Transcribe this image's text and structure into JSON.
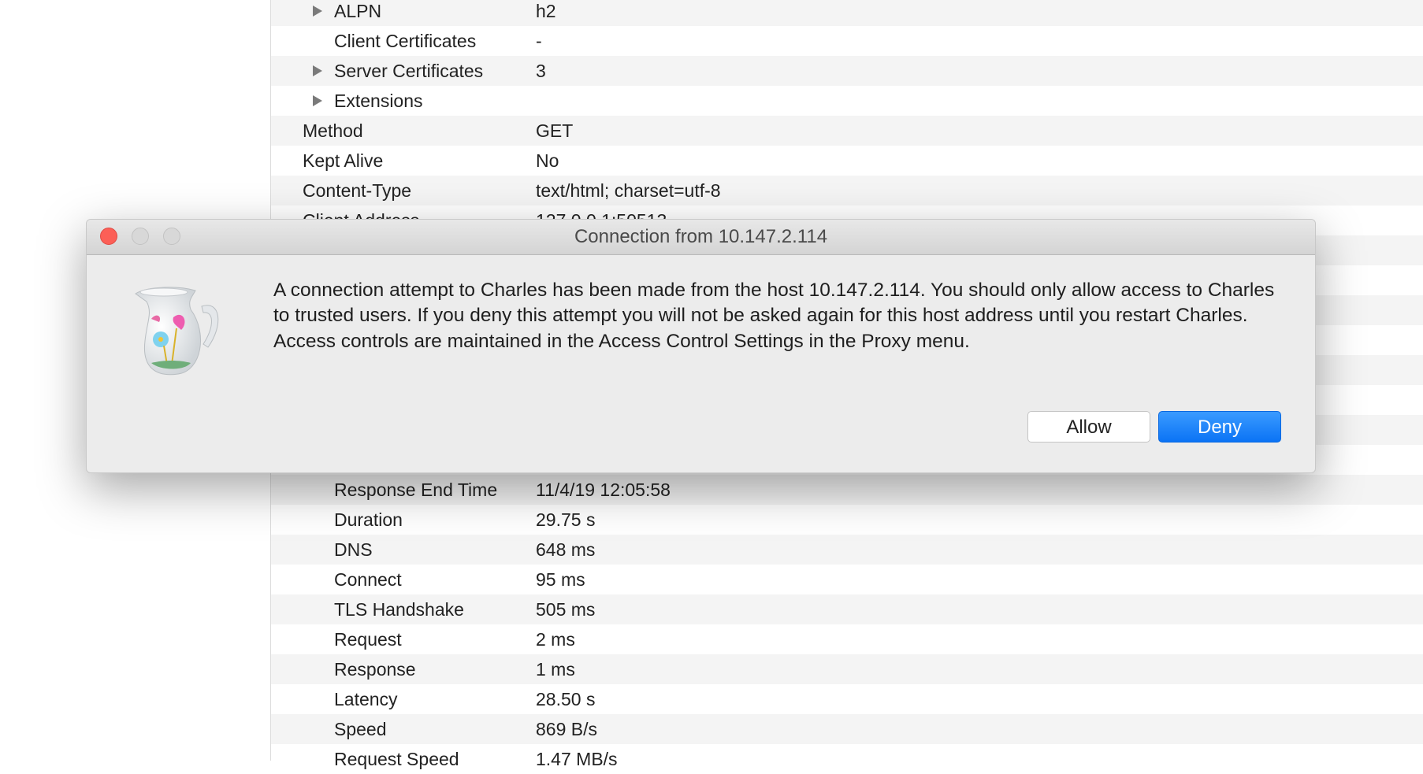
{
  "table": {
    "rows": [
      {
        "label": "ALPN",
        "value": "h2",
        "indent": true,
        "expandable": true
      },
      {
        "label": "Client Certificates",
        "value": "-",
        "indent": true,
        "expandable": false
      },
      {
        "label": "Server Certificates",
        "value": "3",
        "indent": true,
        "expandable": true
      },
      {
        "label": "Extensions",
        "value": "",
        "indent": true,
        "expandable": true
      },
      {
        "label": "Method",
        "value": "GET",
        "indent": false,
        "expandable": false
      },
      {
        "label": "Kept Alive",
        "value": "No",
        "indent": false,
        "expandable": false
      },
      {
        "label": "Content-Type",
        "value": "text/html; charset=utf-8",
        "indent": false,
        "expandable": false
      },
      {
        "label": "Client Address",
        "value": "127.0.0.1:50513",
        "indent": false,
        "expandable": false
      },
      {
        "label": "",
        "value": "",
        "indent": false,
        "expandable": false
      },
      {
        "label": "",
        "value": "",
        "indent": false,
        "expandable": false
      },
      {
        "label": "",
        "value": "",
        "indent": false,
        "expandable": false
      },
      {
        "label": "",
        "value": "",
        "indent": false,
        "expandable": false
      },
      {
        "label": "",
        "value": "",
        "indent": false,
        "expandable": false
      },
      {
        "label": "",
        "value": "",
        "indent": false,
        "expandable": false
      },
      {
        "label": "",
        "value": "",
        "indent": false,
        "expandable": false
      },
      {
        "label": "",
        "value": "",
        "indent": false,
        "expandable": false
      },
      {
        "label": "Response End Time",
        "value": "11/4/19 12:05:58",
        "indent": true,
        "expandable": false
      },
      {
        "label": "Duration",
        "value": "29.75 s",
        "indent": true,
        "expandable": false
      },
      {
        "label": "DNS",
        "value": "648 ms",
        "indent": true,
        "expandable": false
      },
      {
        "label": "Connect",
        "value": "95 ms",
        "indent": true,
        "expandable": false
      },
      {
        "label": "TLS Handshake",
        "value": "505 ms",
        "indent": true,
        "expandable": false
      },
      {
        "label": "Request",
        "value": "2 ms",
        "indent": true,
        "expandable": false
      },
      {
        "label": "Response",
        "value": "1 ms",
        "indent": true,
        "expandable": false
      },
      {
        "label": "Latency",
        "value": "28.50 s",
        "indent": true,
        "expandable": false
      },
      {
        "label": "Speed",
        "value": "869 B/s",
        "indent": true,
        "expandable": false
      },
      {
        "label": "Request Speed",
        "value": "1.47 MB/s",
        "indent": true,
        "expandable": false
      }
    ]
  },
  "dialog": {
    "title": "Connection from 10.147.2.114",
    "icon": "charles-jug-icon",
    "message": "A connection attempt to Charles has been made from the host 10.147.2.114. You should only allow access to Charles to trusted users. If you deny this attempt you will not be asked again for this host address until you restart Charles. Access controls are maintained in the Access Control Settings in the Proxy menu.",
    "allow_label": "Allow",
    "deny_label": "Deny",
    "accent": "#0b73f5"
  }
}
